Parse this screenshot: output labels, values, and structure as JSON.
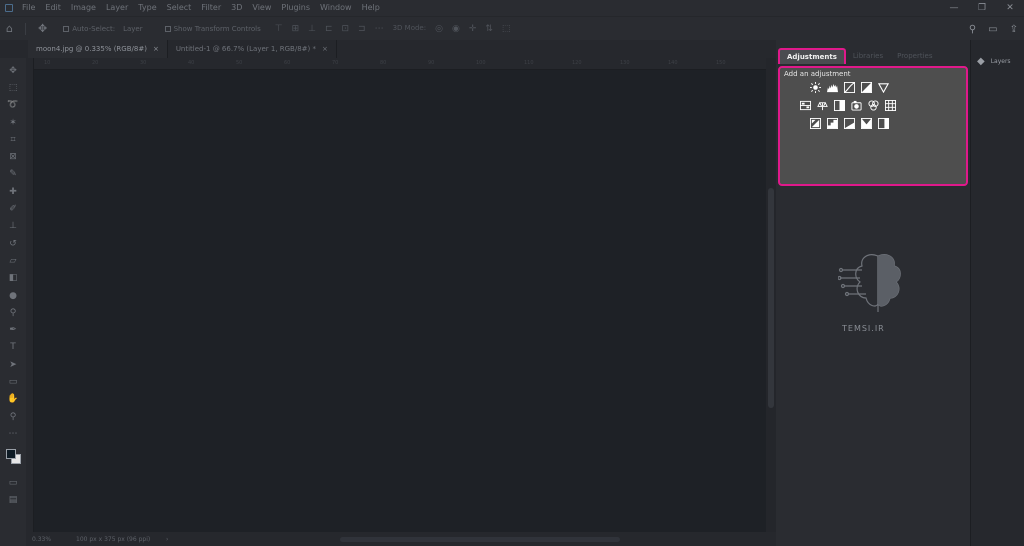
{
  "menu": [
    "File",
    "Edit",
    "Image",
    "Layer",
    "Type",
    "Select",
    "Filter",
    "3D",
    "View",
    "Plugins",
    "Window",
    "Help"
  ],
  "window_controls": [
    "—",
    "❐",
    "✕"
  ],
  "options": {
    "auto_select": "Auto-Select:",
    "layer": "Layer",
    "show_transform": "Show Transform Controls",
    "mode_3d": "3D Mode:"
  },
  "tabs": [
    {
      "label": "moon4.jpg @ 0.335% (RGB/8#)",
      "close": "×"
    },
    {
      "label": "Untitled-1 @ 66.7% (Layer 1, RGB/8#) *",
      "close": "×"
    }
  ],
  "ruler_ticks": [
    "10",
    "20",
    "30",
    "40",
    "50",
    "60",
    "70",
    "80",
    "90",
    "100",
    "110",
    "120",
    "130",
    "140",
    "150"
  ],
  "status": {
    "zoom": "0.33%",
    "info": "100 px x 375 px (96 ppi)",
    "arrow": "›"
  },
  "panels": {
    "tabs": [
      "Adjustments",
      "Libraries",
      "Properties"
    ],
    "adjustments_title": "Add an adjustment"
  },
  "watermark": {
    "text": "TEMSI.IR"
  },
  "right_strip": {
    "layers_label": "Layers"
  },
  "accent_color": "#e0198b"
}
